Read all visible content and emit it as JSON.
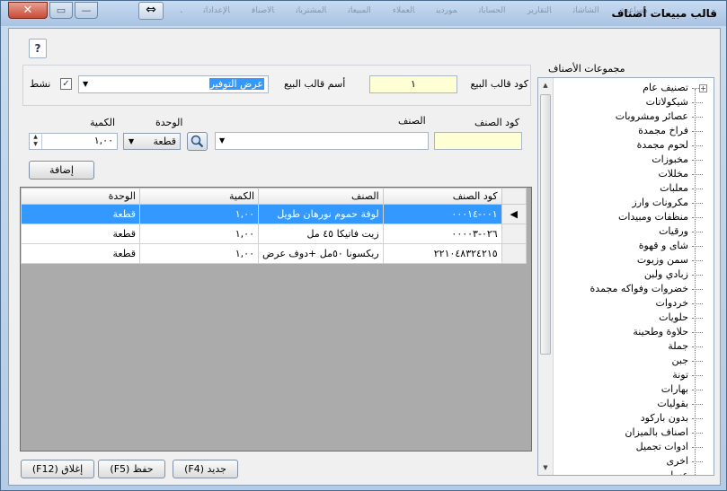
{
  "window": {
    "title": "قالب مبيعات أصناف",
    "close_glyph": "✕",
    "max_glyph": "▭",
    "min_glyph": "—",
    "swap_glyph": "⇔",
    "background_menu": [
      "مساعدة",
      "الشاشات",
      "التقارير",
      "الحسابات",
      "موردين",
      "العملاء",
      "المبيعات",
      "المشتريات",
      "الأصناف",
      "الإعدادات",
      "ملف"
    ]
  },
  "help_label": "?",
  "template": {
    "code_label": "كود قالب البيع",
    "code_value": "١",
    "name_label": "أسم قالب البيع",
    "name_value": "عرض التوفير",
    "active_label": "نشط",
    "active_checked": true
  },
  "entry": {
    "item_code_label": "كود الصنف",
    "item_code_value": "",
    "item_label": "الصنف",
    "item_value": "",
    "unit_label": "الوحدة",
    "unit_value": "قطعة",
    "qty_label": "الكمية",
    "qty_value": "١,٠٠",
    "add_button": "إضافة"
  },
  "table": {
    "columns": [
      "كود الصنف",
      "الصنف",
      "الكمية",
      "الوحدة"
    ],
    "rows": [
      {
        "code": "٠٠١-٠٠٠١٤",
        "item": "لوفة حموم نورهان طويل",
        "qty": "١,٠٠",
        "unit": "قطعة",
        "selected": true
      },
      {
        "code": "٠٢٦-٠٠٠٠٣",
        "item": "زيت فاتيكا ٤٥ مل",
        "qty": "١,٠٠",
        "unit": "قطعة",
        "selected": false
      },
      {
        "code": "٢٢١٠٤٨٣٢٤٢١٥",
        "item": "ريكسونا ٥٠مل +دوف عرض",
        "qty": "١,٠٠",
        "unit": "قطعة",
        "selected": false
      }
    ]
  },
  "groups": {
    "label": "مجموعات الأصناف",
    "items": [
      "تصنيف عام",
      "شيكولاتات",
      "عصائر ومشروبات",
      "فراخ مجمدة",
      "لحوم مجمدة",
      "مخبوزات",
      "مخللات",
      "معلبات",
      "مكرونات وارز",
      "منظفات ومبيدات",
      "ورقيات",
      "شاى و قهوة",
      "سمن وزيوت",
      "زبادي ولبن",
      "خضروات وفواكه مجمدة",
      "خردوات",
      "حلويات",
      "حلاوة وطحينة",
      "جملة",
      "جبن",
      "تونة",
      "بهارات",
      "بقوليات",
      "بدون باركود",
      "اصناف بالميزان",
      "ادوات تجميل",
      "اخرى",
      "عسل"
    ]
  },
  "footer": {
    "new_button": "جديد (F4)",
    "save_button": "حفظ (F5)",
    "close_button": "إغلاق (F12)"
  },
  "colors": {
    "selection": "#3399ff",
    "yellow_field": "#ffffd6",
    "close_button": "#c74b35"
  }
}
